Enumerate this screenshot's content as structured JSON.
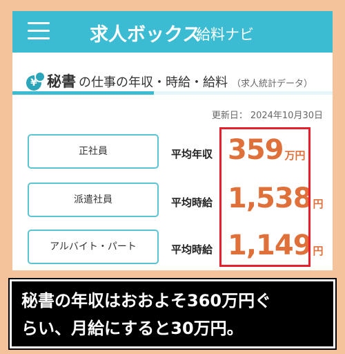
{
  "header": {
    "brand": "求人ボックス",
    "brand_sub": "給料ナビ"
  },
  "section": {
    "job": "秘書",
    "title_rest": "の仕事の年収・時給・給料",
    "note": "（求人統計データ）"
  },
  "updated": {
    "label": "更新日：",
    "date": "2024年10月30日"
  },
  "rows": [
    {
      "type": "正社員",
      "pay_label": "平均年収",
      "amount": "359",
      "unit": "万円"
    },
    {
      "type": "派遣社員",
      "pay_label": "平均時給",
      "amount": "1,538",
      "unit": "円"
    },
    {
      "type": "アルバイト・パート",
      "pay_label": "平均時給",
      "amount": "1,149",
      "unit": "円"
    }
  ],
  "caption": {
    "line1": "秘書の年収はおおよそ360万円ぐ",
    "line2": "らい、月給にすると30万円。"
  },
  "colors": {
    "brand": "#3bbcd3",
    "amount": "#e0703a",
    "highlight": "#e5202a",
    "background": "#f4c39c"
  }
}
